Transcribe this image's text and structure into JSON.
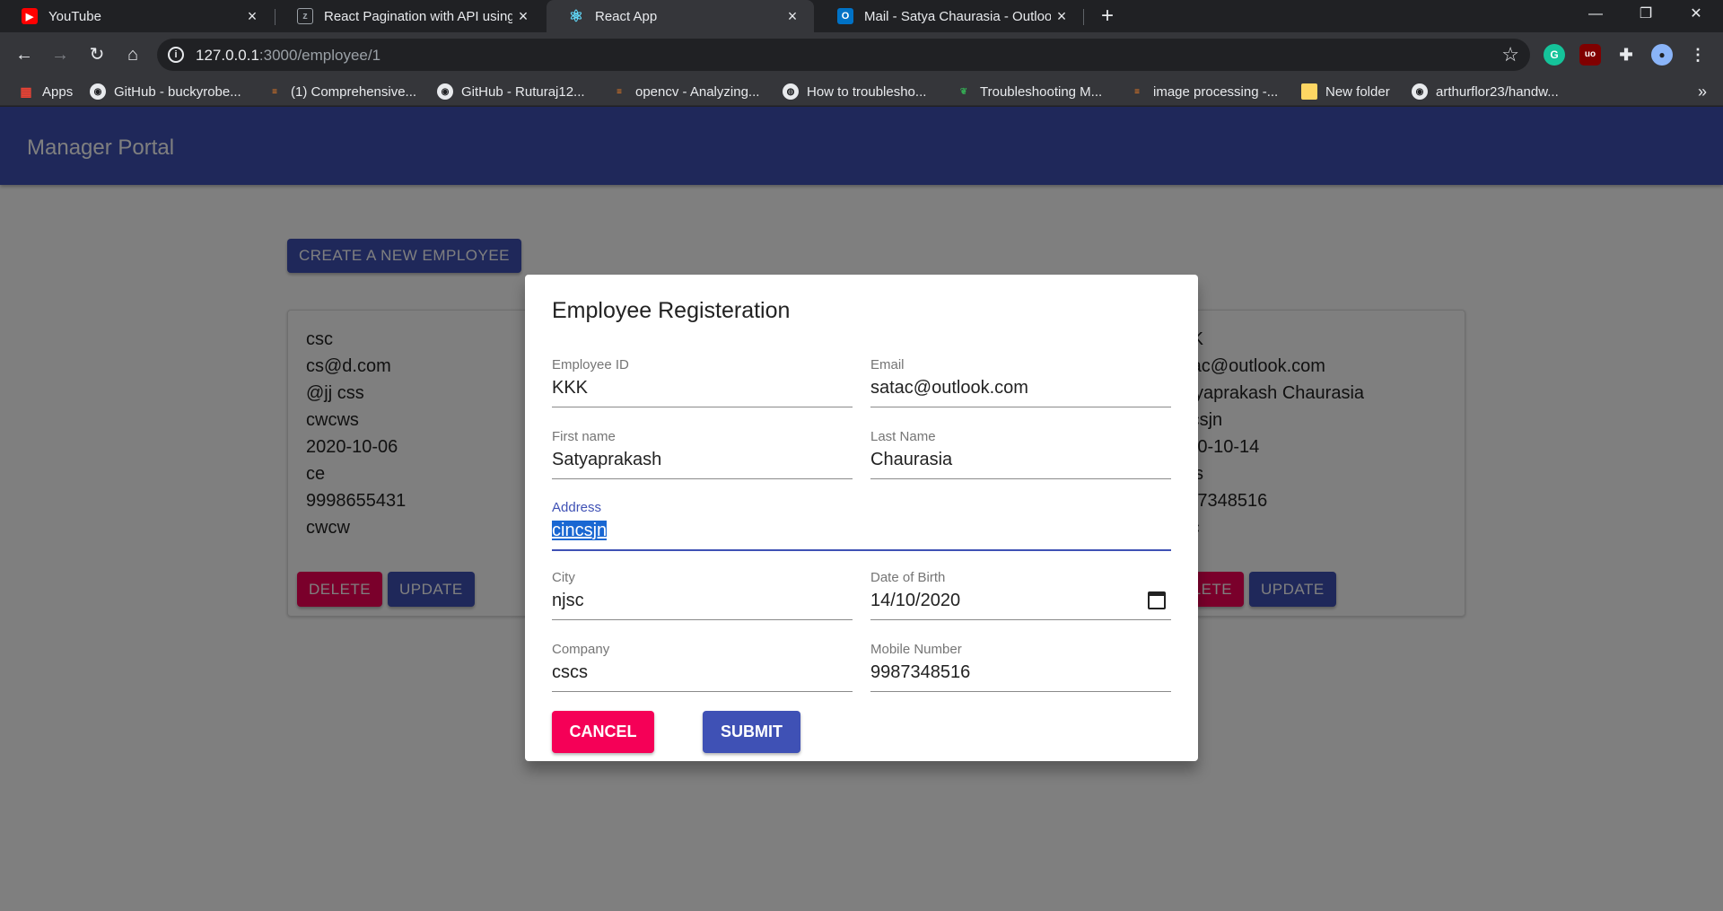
{
  "browser": {
    "tabs": [
      {
        "title": "YouTube",
        "icon": "youtube-icon",
        "active": false
      },
      {
        "title": "React Pagination with API using M",
        "icon": "zest-icon",
        "active": false
      },
      {
        "title": "React App",
        "icon": "react-icon",
        "active": true
      },
      {
        "title": "Mail - Satya Chaurasia - Outlook",
        "icon": "outlook-icon",
        "active": false
      }
    ],
    "url_host": "127.0.0.1",
    "url_path": ":3000/employee/1",
    "bookmarks": [
      {
        "label": "Apps",
        "icon": "apps-grid-icon"
      },
      {
        "label": "GitHub - buckyrobe...",
        "icon": "github-icon"
      },
      {
        "label": "(1) Comprehensive...",
        "icon": "stackoverflow-icon"
      },
      {
        "label": "GitHub - Ruturaj12...",
        "icon": "github-icon"
      },
      {
        "label": "opencv - Analyzing...",
        "icon": "stackoverflow-icon"
      },
      {
        "label": "How to troublesho...",
        "icon": "globe-icon"
      },
      {
        "label": "Troubleshooting M...",
        "icon": "leaf-icon"
      },
      {
        "label": "image processing -...",
        "icon": "stackoverflow-icon"
      },
      {
        "label": "New folder",
        "icon": "folder-icon"
      },
      {
        "label": "arthurflor23/handw...",
        "icon": "github-icon"
      }
    ]
  },
  "app": {
    "title": "Manager Portal",
    "create_button": "CREATE A NEW EMPLOYEE",
    "cards": [
      {
        "lines": [
          "csc",
          "cs@d.com",
          "@jj css",
          "cwcws",
          "2020-10-06",
          "ce",
          "9998655431",
          "cwcw"
        ],
        "delete": "DELETE",
        "update": "UPDATE"
      },
      {
        "lines": [
          "KKK",
          "satac@outlook.com",
          "Satyaprakash Chaurasia",
          "cincsjn",
          "2020-10-14",
          "cscs",
          "9987348516",
          "njsc"
        ],
        "delete": "DELETE",
        "update": "UPDATE"
      }
    ]
  },
  "dialog": {
    "title": "Employee Registeration",
    "fields": {
      "employee_id": {
        "label": "Employee ID",
        "value": "KKK"
      },
      "email": {
        "label": "Email",
        "value": "satac@outlook.com"
      },
      "first_name": {
        "label": "First name",
        "value": "Satyaprakash"
      },
      "last_name": {
        "label": "Last Name",
        "value": "Chaurasia"
      },
      "address": {
        "label": "Address",
        "value": "cincsjn"
      },
      "city": {
        "label": "City",
        "value": "njsc"
      },
      "dob": {
        "label": "Date of Birth",
        "value": "14/10/2020"
      },
      "company": {
        "label": "Company",
        "value": "cscs"
      },
      "mobile": {
        "label": "Mobile Number",
        "value": "9987348516"
      }
    },
    "cancel": "CANCEL",
    "submit": "SUBMIT"
  },
  "colors": {
    "primary": "#3f51b5",
    "secondary": "#f50057",
    "selection": "#1967d2"
  }
}
